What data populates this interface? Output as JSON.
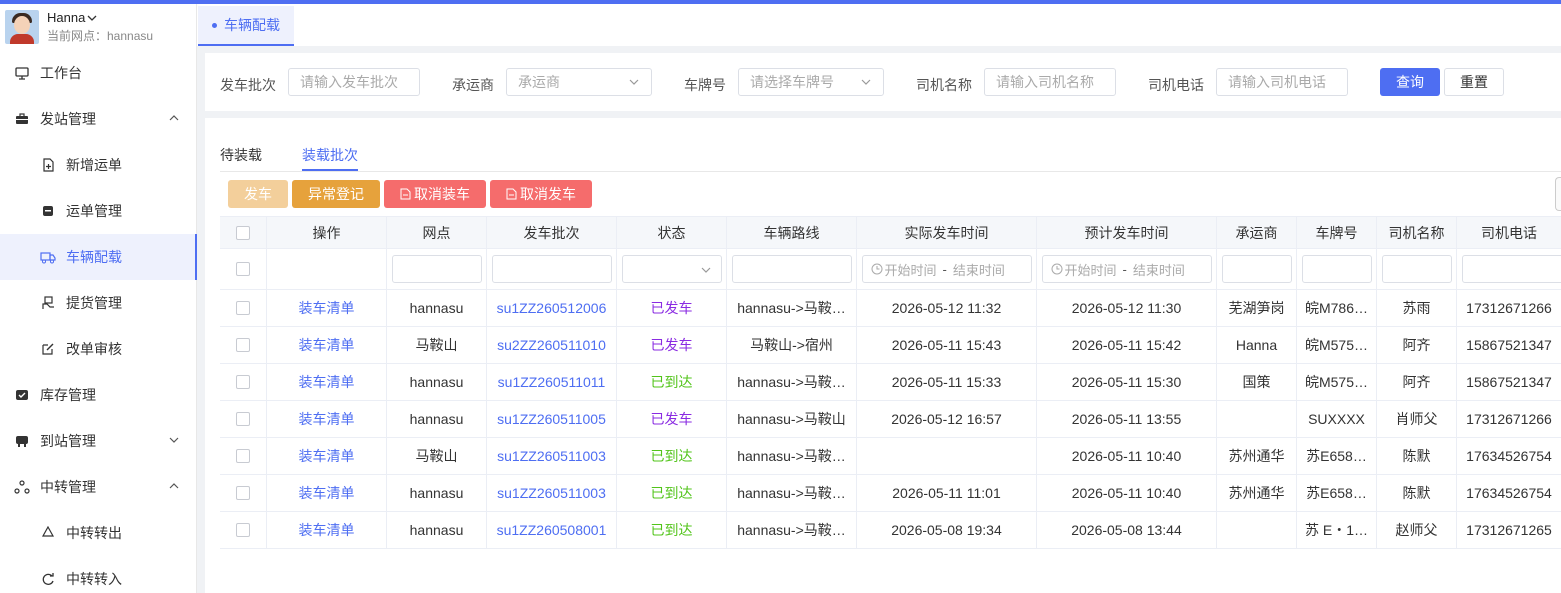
{
  "user": {
    "name": "Hanna",
    "site_label": "当前网点：hannasu"
  },
  "sidebar": {
    "items": [
      {
        "label": "工作台",
        "icon": "monitor-icon"
      },
      {
        "label": "发站管理",
        "icon": "briefcase-icon"
      },
      {
        "label": "新增运单",
        "icon": "file-add-icon"
      },
      {
        "label": "运单管理",
        "icon": "box-icon"
      },
      {
        "label": "车辆配载",
        "icon": "truck-icon"
      },
      {
        "label": "提货管理",
        "icon": "hand-package-icon"
      },
      {
        "label": "改单审核",
        "icon": "edit-icon"
      },
      {
        "label": "库存管理",
        "icon": "inventory-icon"
      },
      {
        "label": "到站管理",
        "icon": "arrival-icon"
      },
      {
        "label": "中转管理",
        "icon": "transfer-icon"
      },
      {
        "label": "中转转出",
        "icon": "transfer-out-icon"
      },
      {
        "label": "中转转入",
        "icon": "transfer-in-icon"
      }
    ]
  },
  "tabbar": {
    "active_tab": "车辆配载"
  },
  "filter": {
    "batch_label": "发车批次",
    "batch_placeholder": "请输入发车批次",
    "carrier_label": "承运商",
    "carrier_placeholder": "承运商",
    "plate_label": "车牌号",
    "plate_placeholder": "请选择车牌号",
    "driver_label": "司机名称",
    "driver_placeholder": "请输入司机名称",
    "phone_label": "司机电话",
    "phone_placeholder": "请输入司机电话",
    "search_label": "查询",
    "reset_label": "重置"
  },
  "tabs": {
    "pending": "待装载",
    "batches": "装载批次"
  },
  "actions": {
    "depart": "发车",
    "exception": "异常登记",
    "cancel_load": "取消装车",
    "cancel_depart": "取消发车"
  },
  "colors": {
    "primary": "#4e6ef2",
    "depart_disabled": "#f3cf9b",
    "exception": "#e6a23c",
    "danger": "#f56c6c",
    "sent": "#8a2be2",
    "arrived": "#52c41a"
  },
  "table": {
    "headers": [
      "操作",
      "网点",
      "发车批次",
      "状态",
      "车辆路线",
      "实际发车时间",
      "预计发车时间",
      "承运商",
      "车牌号",
      "司机名称",
      "司机电话"
    ],
    "date_placeholder": {
      "start": "开始时间",
      "sep": "-",
      "end": "结束时间"
    },
    "rows": [
      {
        "op": "装车清单",
        "site": "hannasu",
        "batch": "su1ZZ260512006",
        "status": "已发车",
        "route": "hannasu->马鞍…",
        "actual": "2026-05-12 11:32",
        "plan": "2026-05-12 11:30",
        "carrier": "芜湖笋岗",
        "plate": "皖M786…",
        "driver": "苏雨",
        "phone": "17312671266"
      },
      {
        "op": "装车清单",
        "site": "马鞍山",
        "batch": "su2ZZ260511010",
        "status": "已发车",
        "route": "马鞍山->宿州",
        "actual": "2026-05-11 15:43",
        "plan": "2026-05-11 15:42",
        "carrier": "Hanna",
        "plate": "皖M575…",
        "driver": "阿齐",
        "phone": "15867521347"
      },
      {
        "op": "装车清单",
        "site": "hannasu",
        "batch": "su1ZZ260511011",
        "status": "已到达",
        "route": "hannasu->马鞍…",
        "actual": "2026-05-11 15:33",
        "plan": "2026-05-11 15:30",
        "carrier": "国策",
        "plate": "皖M575…",
        "driver": "阿齐",
        "phone": "15867521347"
      },
      {
        "op": "装车清单",
        "site": "hannasu",
        "batch": "su1ZZ260511005",
        "status": "已发车",
        "route": "hannasu->马鞍山",
        "actual": "2026-05-12 16:57",
        "plan": "2026-05-11 13:55",
        "carrier": "",
        "plate": "SUXXXX",
        "driver": "肖师父",
        "phone": "17312671266"
      },
      {
        "op": "装车清单",
        "site": "马鞍山",
        "batch": "su1ZZ260511003",
        "status": "已到达",
        "route": "hannasu->马鞍…",
        "actual": "",
        "plan": "2026-05-11 10:40",
        "carrier": "苏州通华",
        "plate": "苏E658…",
        "driver": "陈默",
        "phone": "17634526754"
      },
      {
        "op": "装车清单",
        "site": "hannasu",
        "batch": "su1ZZ260511003",
        "status": "已到达",
        "route": "hannasu->马鞍…",
        "actual": "2026-05-11 11:01",
        "plan": "2026-05-11 10:40",
        "carrier": "苏州通华",
        "plate": "苏E658…",
        "driver": "陈默",
        "phone": "17634526754"
      },
      {
        "op": "装车清单",
        "site": "hannasu",
        "batch": "su1ZZ260508001",
        "status": "已到达",
        "route": "hannasu->马鞍…",
        "actual": "2026-05-08 19:34",
        "plan": "2026-05-08 13:44",
        "carrier": "",
        "plate": "苏 E・1…",
        "driver": "赵师父",
        "phone": "17312671265"
      }
    ]
  }
}
